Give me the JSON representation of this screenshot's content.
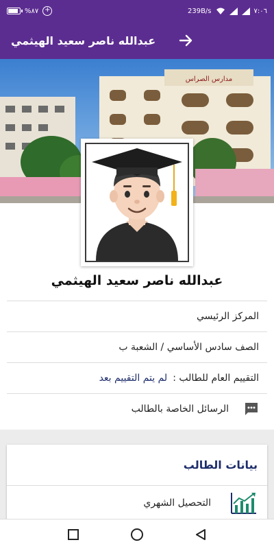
{
  "status_bar": {
    "battery_text": "%٨٧",
    "battery_level": 0.87,
    "network_speed": "239B/s",
    "time": "٧:٠٦"
  },
  "app_bar": {
    "title": "عبدالله ناصر سعيد الهيثمي",
    "back_icon": "arrow-right-icon"
  },
  "hero": {
    "building_sign": "مدارس الصراس"
  },
  "student": {
    "name": "عبدالله ناصر سعيد الهيثمي",
    "center": "المركز الرئيسي",
    "class": "الصف سادس الأساسي / الشعبة ب",
    "evaluation_label": "التقييم العام للطالب :",
    "evaluation_value": "لم يتم التقييم بعد",
    "messages_label": "الرسائل الخاصة بالطالب",
    "messages_icon": "chat-bubble-icon"
  },
  "student_data": {
    "title": "بيانات الطالب",
    "items": [
      {
        "label": "التحصيل الشهري",
        "icon": "line-chart-icon"
      }
    ]
  },
  "colors": {
    "primary": "#5c2d91",
    "accent_text": "#1d2d6b",
    "chart_icon": "#1e8a6e"
  },
  "navbar": {
    "icons": [
      "recent-apps-icon",
      "home-icon",
      "back-icon"
    ]
  }
}
